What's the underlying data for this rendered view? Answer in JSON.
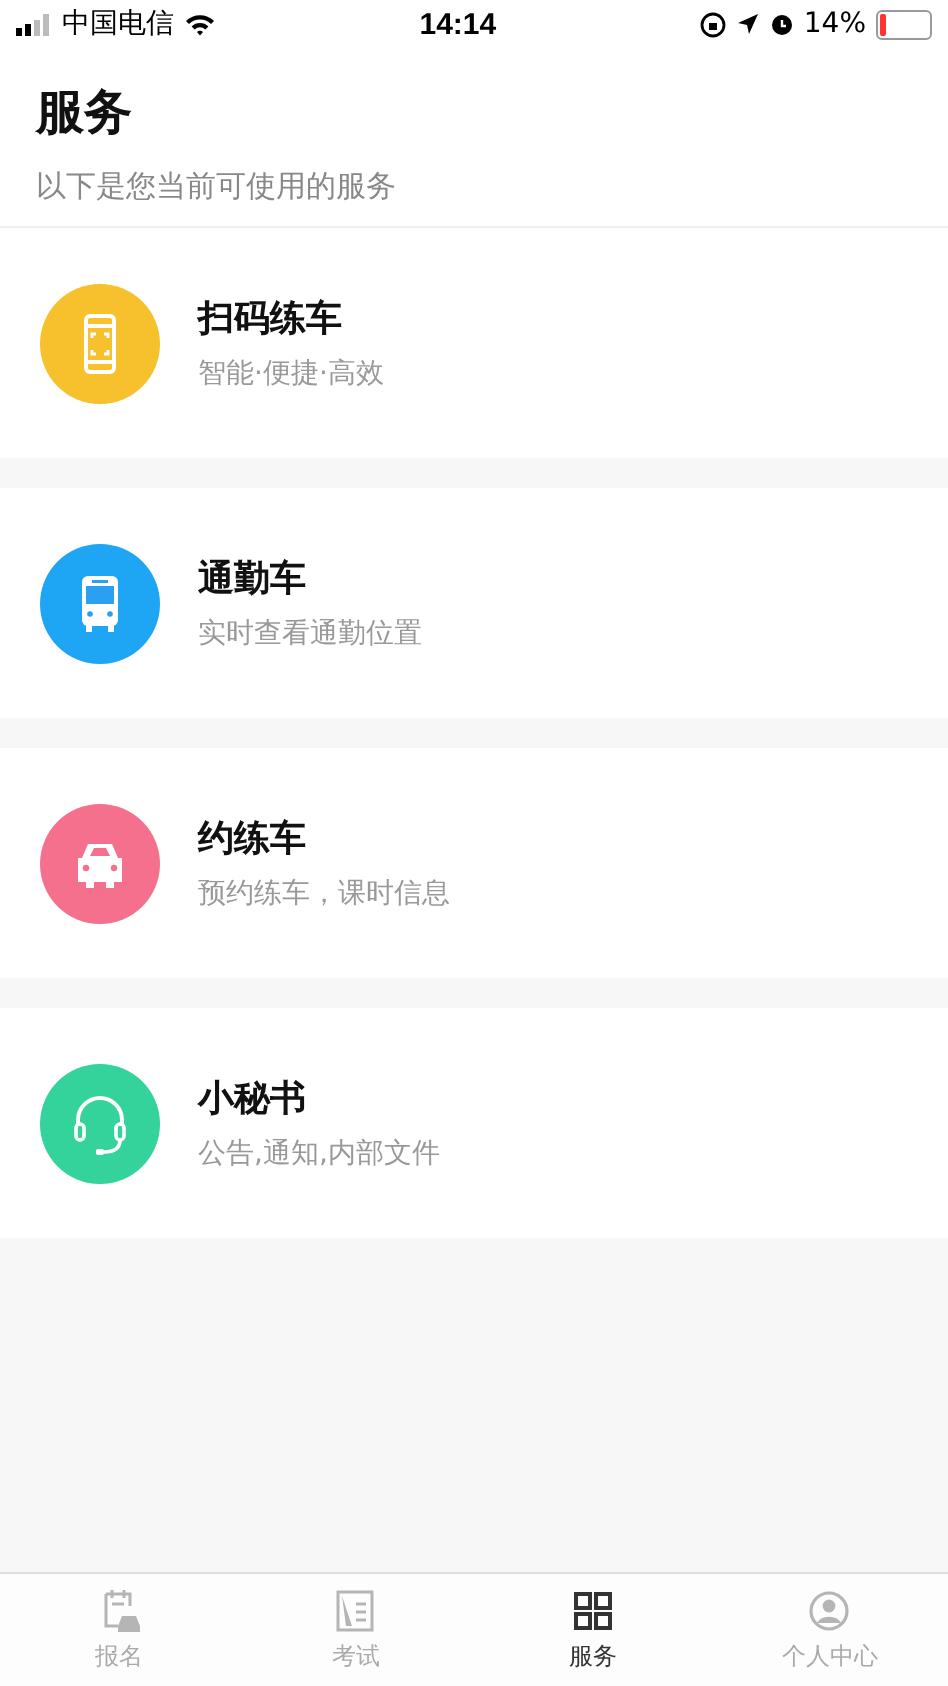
{
  "status_bar": {
    "carrier": "中国电信",
    "time": "14:14",
    "battery": "14%"
  },
  "header": {
    "title": "服务",
    "subtitle": "以下是您当前可使用的服务"
  },
  "services": [
    {
      "kind": "scan",
      "color": "#f6c12c",
      "title": "扫码练车",
      "subtitle": "智能·便捷·高效"
    },
    {
      "kind": "bus",
      "color": "#1ea6f5",
      "title": "通勤车",
      "subtitle": "实时查看通勤位置"
    },
    {
      "kind": "car",
      "color": "#f5708c",
      "title": "约练车",
      "subtitle": "预约练车，课时信息"
    },
    {
      "kind": "headset",
      "color": "#34d39b",
      "title": "小秘书",
      "subtitle": "公告,通知,内部文件"
    }
  ],
  "tabs": [
    {
      "kind": "signup",
      "label": "报名",
      "selected": false
    },
    {
      "kind": "exam",
      "label": "考试",
      "selected": false
    },
    {
      "kind": "services",
      "label": "服务",
      "selected": true
    },
    {
      "kind": "profile",
      "label": "个人中心",
      "selected": false
    }
  ]
}
